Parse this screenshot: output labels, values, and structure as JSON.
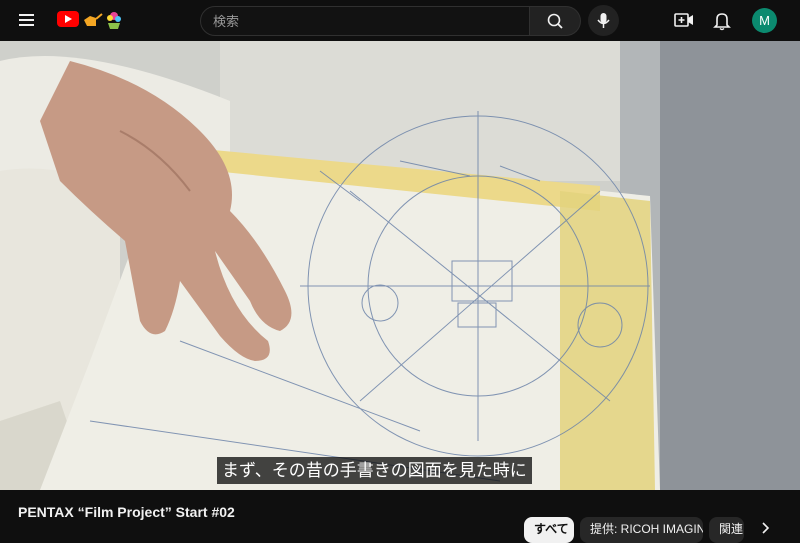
{
  "header": {
    "search_placeholder": "検索",
    "avatar_initial": "M"
  },
  "icons": {
    "menu": "hamburger-menu-icon",
    "logo": "youtube-logo-icon",
    "doodle": "watering-can-flower-doodle-icon",
    "search": "search-icon",
    "mic": "microphone-icon",
    "create": "create-video-icon",
    "bell": "notifications-bell-icon",
    "next": "chevron-right-icon"
  },
  "player": {
    "caption": "まず、その昔の手書きの図面を見た時に"
  },
  "video": {
    "title": "PENTAX “Film Project” Start #02"
  },
  "chips": {
    "all": "すべて",
    "provided": "提供: RICOH IMAGING",
    "related": "関連"
  },
  "colors": {
    "brand_red": "#ff0000",
    "avatar_bg": "#0b8a6f",
    "background": "#0f0f0f"
  }
}
